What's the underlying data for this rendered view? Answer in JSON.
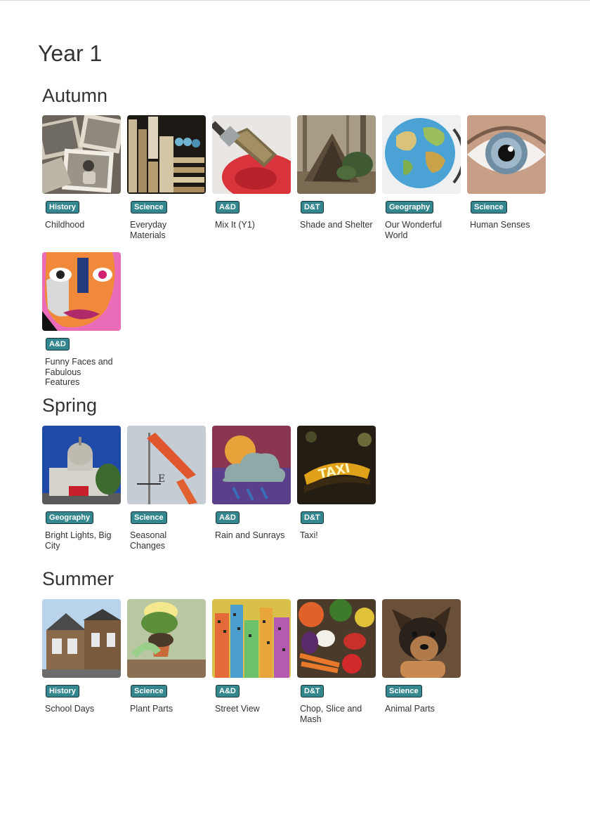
{
  "page": {
    "year_title": "Year 1"
  },
  "terms": [
    {
      "title": "Autumn",
      "units": [
        {
          "subject": "History",
          "title": "Childhood",
          "image": "old-photographs-image"
        },
        {
          "subject": "Science",
          "title": "Everyday Materials",
          "image": "material-shelves-image"
        },
        {
          "subject": "A&D",
          "title": "Mix It (Y1)",
          "image": "paintbrush-image"
        },
        {
          "subject": "D&T",
          "title": "Shade and Shelter",
          "image": "woodland-shelter-image"
        },
        {
          "subject": "Geography",
          "title": "Our Wonderful World",
          "image": "globe-image"
        },
        {
          "subject": "Science",
          "title": "Human Senses",
          "image": "eye-image"
        },
        {
          "subject": "A&D",
          "title": "Funny Faces and Fabulous Features",
          "image": "collage-face-image"
        }
      ]
    },
    {
      "title": "Spring",
      "units": [
        {
          "subject": "Geography",
          "title": "Bright Lights, Big City",
          "image": "st-pauls-cathedral-image"
        },
        {
          "subject": "Science",
          "title": "Seasonal Changes",
          "image": "windsock-image"
        },
        {
          "subject": "A&D",
          "title": "Rain and Sunrays",
          "image": "cloud-print-image"
        },
        {
          "subject": "D&T",
          "title": "Taxi!",
          "image": "taxi-sign-image"
        }
      ]
    },
    {
      "title": "Summer",
      "units": [
        {
          "subject": "History",
          "title": "School Days",
          "image": "school-building-image"
        },
        {
          "subject": "Science",
          "title": "Plant Parts",
          "image": "potted-plant-image"
        },
        {
          "subject": "A&D",
          "title": "Street View",
          "image": "city-drawing-image"
        },
        {
          "subject": "D&T",
          "title": "Chop, Slice and Mash",
          "image": "vegetables-image"
        },
        {
          "subject": "Science",
          "title": "Animal Parts",
          "image": "puppy-image"
        }
      ]
    }
  ],
  "colors": {
    "tag_bg": "#34868f",
    "tag_border": "#17353a",
    "text": "#333333"
  }
}
